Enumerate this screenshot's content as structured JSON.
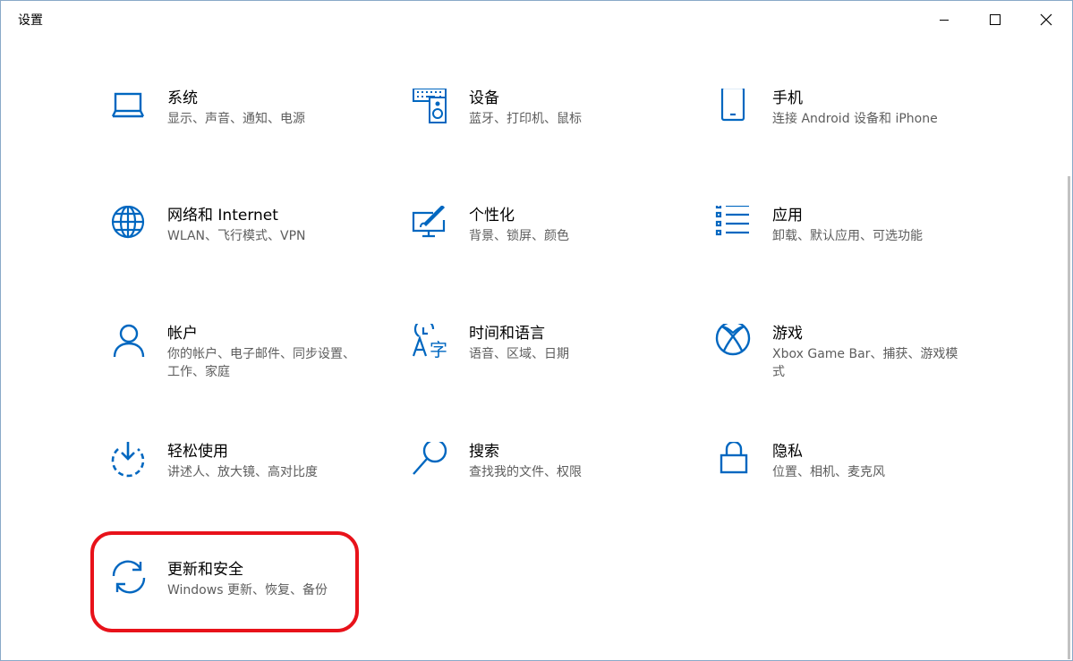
{
  "window": {
    "title": "设置"
  },
  "accent_color": "#0067c0",
  "highlight_color": "#e8121a",
  "tiles": [
    {
      "name": "系统",
      "desc": "显示、声音、通知、电源",
      "icon": "laptop-icon"
    },
    {
      "name": "设备",
      "desc": "蓝牙、打印机、鼠标",
      "icon": "keyboard-speaker-icon"
    },
    {
      "name": "手机",
      "desc": "连接 Android 设备和 iPhone",
      "icon": "phone-icon"
    },
    {
      "name": "网络和 Internet",
      "desc": "WLAN、飞行模式、VPN",
      "icon": "globe-icon"
    },
    {
      "name": "个性化",
      "desc": "背景、锁屏、颜色",
      "icon": "monitor-brush-icon"
    },
    {
      "name": "应用",
      "desc": "卸载、默认应用、可选功能",
      "icon": "app-list-icon"
    },
    {
      "name": "帐户",
      "desc": "你的帐户、电子邮件、同步设置、工作、家庭",
      "icon": "person-icon"
    },
    {
      "name": "时间和语言",
      "desc": "语音、区域、日期",
      "icon": "time-language-icon"
    },
    {
      "name": "游戏",
      "desc": "Xbox Game Bar、捕获、游戏模式",
      "icon": "xbox-icon"
    },
    {
      "name": "轻松使用",
      "desc": "讲述人、放大镜、高对比度",
      "icon": "ease-of-access-icon"
    },
    {
      "name": "搜索",
      "desc": "查找我的文件、权限",
      "icon": "search-icon"
    },
    {
      "name": "隐私",
      "desc": "位置、相机、麦克风",
      "icon": "lock-icon"
    },
    {
      "name": "更新和安全",
      "desc": "Windows 更新、恢复、备份",
      "icon": "sync-icon"
    }
  ]
}
